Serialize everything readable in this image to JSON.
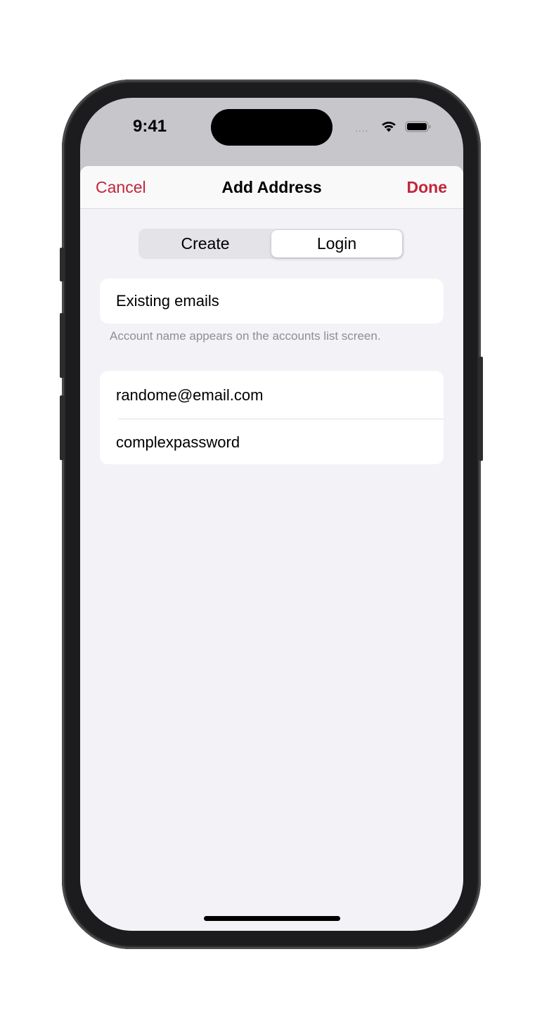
{
  "status_bar": {
    "time": "9:41",
    "signal": "....",
    "wifi_icon": "wifi-icon",
    "battery_icon": "battery-icon"
  },
  "nav": {
    "cancel_label": "Cancel",
    "title": "Add Address",
    "done_label": "Done",
    "accent_color": "#c1263b"
  },
  "segmented": {
    "options": [
      "Create",
      "Login"
    ],
    "selected": "Login"
  },
  "account_name": {
    "value": "Existing emails",
    "footer": "Account name appears on the accounts list screen."
  },
  "credentials": {
    "email": "randome@email.com",
    "password": "complexpassword"
  }
}
